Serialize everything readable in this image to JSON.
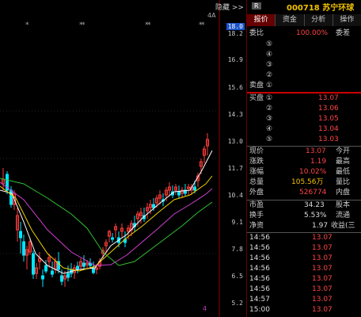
{
  "toolbar": {
    "hide_label": "隐藏 >>"
  },
  "chart": {
    "star_label": "*",
    "top_right_label": "4A",
    "bottom_label": "4",
    "price_axis": [
      "18.0",
      "18.2",
      "16.9",
      "15.6",
      "14.3",
      "13.0",
      "11.7",
      "10.4",
      "9.1",
      "7.8",
      "6.5",
      "5.2"
    ],
    "highlight_price": "18.0",
    "colors": {
      "up": "#ff3b3b",
      "down": "#00e5ff",
      "ma5": "#ffffff",
      "ma10": "#f0d000",
      "ma20": "#d040d0",
      "ma60": "#30c030"
    }
  },
  "header": {
    "badge": "R",
    "code_name": "000718 苏宁环球"
  },
  "tabs": [
    "报价",
    "资金",
    "分析",
    "操作"
  ],
  "order_book": {
    "ratio_label": "委比",
    "ratio_value": "100.00%",
    "diff_label": "委差",
    "sell_label": "卖盘",
    "buy_label": "买盘",
    "sell_levels": [
      "⑤",
      "④",
      "③",
      "②",
      "①"
    ],
    "buy_levels": [
      {
        "level": "①",
        "price": "13.07"
      },
      {
        "level": "②",
        "price": "13.06"
      },
      {
        "level": "③",
        "price": "13.05"
      },
      {
        "level": "④",
        "price": "13.04"
      },
      {
        "level": "⑤",
        "price": "13.03"
      }
    ]
  },
  "quote": [
    {
      "label": "现价",
      "value": "13.07",
      "right": "今开",
      "color": "#ff4444"
    },
    {
      "label": "涨跌",
      "value": "1.19",
      "right": "最高",
      "color": "#ff4444"
    },
    {
      "label": "涨幅",
      "value": "10.02%",
      "right": "最低",
      "color": "#ff4444"
    },
    {
      "label": "总量",
      "value": "105.56万",
      "right": "量比",
      "color": "#f2c200"
    },
    {
      "label": "外盘",
      "value": "526774",
      "right": "内盘",
      "color": "#ff4444"
    }
  ],
  "stats": [
    {
      "label": "市盈",
      "value": "34.23",
      "right": "股本"
    },
    {
      "label": "换手",
      "value": "5.53%",
      "right": "流通"
    },
    {
      "label": "净资",
      "value": "1.97",
      "right": "收益(三"
    }
  ],
  "ticks": [
    {
      "time": "14:56",
      "price": "13.07"
    },
    {
      "time": "14:56",
      "price": "13.07"
    },
    {
      "time": "14:56",
      "price": "13.07"
    },
    {
      "time": "14:56",
      "price": "13.07"
    },
    {
      "time": "14:56",
      "price": "13.07"
    },
    {
      "time": "14:56",
      "price": "13.07"
    },
    {
      "time": "14:57",
      "price": "13.07"
    },
    {
      "time": "15:00",
      "price": "13.07"
    }
  ]
}
